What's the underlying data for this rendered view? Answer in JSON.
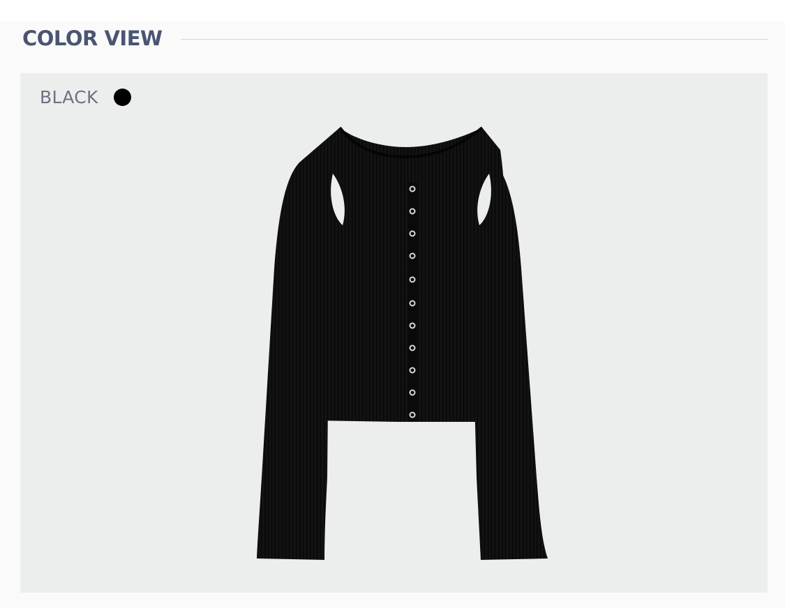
{
  "section": {
    "title": "COLOR VIEW"
  },
  "colors": [
    {
      "name": "BLACK",
      "swatch": "#000000"
    }
  ],
  "theme": {
    "title_color": "#4a5572",
    "panel_background": "#eceeee"
  },
  "product": {
    "garment_color": "#111111",
    "snap_button_count": 11
  }
}
